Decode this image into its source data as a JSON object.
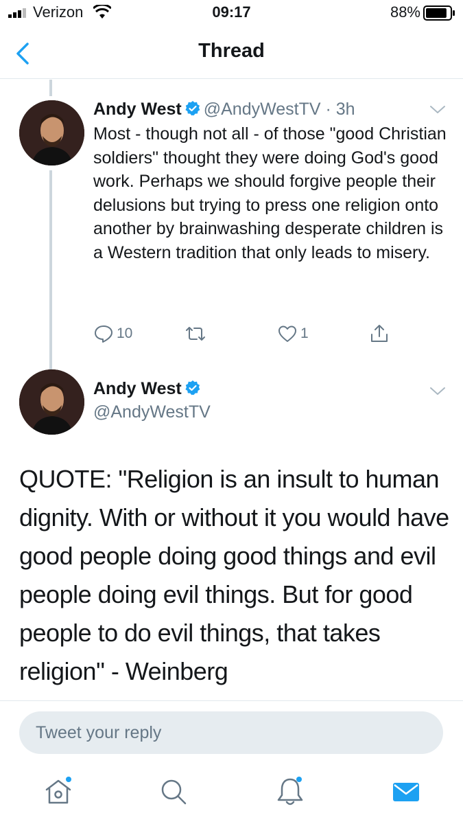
{
  "status_bar": {
    "carrier": "Verizon",
    "time": "09:17",
    "battery_percent": "88%",
    "battery_level": 0.88
  },
  "nav": {
    "title": "Thread"
  },
  "tweets": [
    {
      "name": "Andy West",
      "handle": "@AndyWestTV",
      "time": "· 3h",
      "verified": true,
      "text": "Most - though not all - of those \"good Christian soldiers\" thought they were doing God's good work. Perhaps we should forgive people their delusions but trying to press one religion onto another by brainwashing desperate children is a Western tradition that only leads to misery.",
      "reply_count": "10",
      "retweet_count": "",
      "like_count": "1"
    },
    {
      "name": "Andy West",
      "handle": "@AndyWestTV",
      "verified": true,
      "text": "QUOTE: \"Religion is an insult to human dignity. With or without it you would have good people doing good things and evil people doing evil things. But for good people to do evil things, that takes religion\" - Weinberg"
    }
  ],
  "reply": {
    "placeholder": "Tweet your reply"
  },
  "colors": {
    "accent": "#1da1f2",
    "secondary_text": "#657786"
  }
}
